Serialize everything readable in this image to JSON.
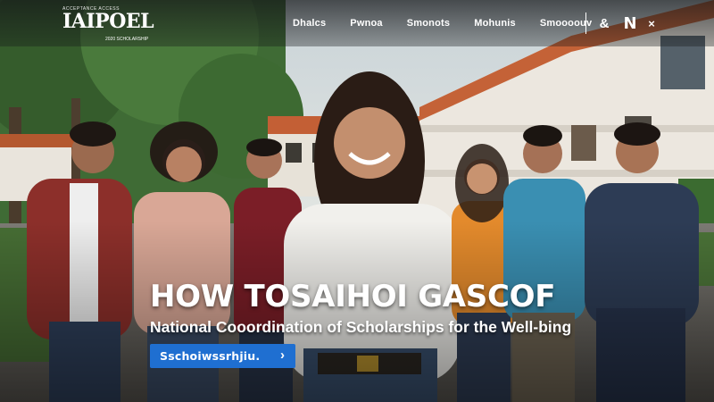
{
  "logo": {
    "small_top": "ACCEPTANCE ACCESS",
    "wordmark": "IAIPOEL",
    "tagline": "2020 SCHOLARSHIP"
  },
  "nav": {
    "items": [
      {
        "label": "Dhalcs"
      },
      {
        "label": "Pwnoa"
      },
      {
        "label": "Smonots"
      },
      {
        "label": "Mohunis"
      },
      {
        "label": "Smoooouv"
      }
    ],
    "icons": [
      "accessibility-icon",
      "n-icon",
      "close-icon"
    ],
    "icon_glyphs": {
      "accessibility": "&",
      "n": "N",
      "close": "×"
    }
  },
  "hero": {
    "title": "HOW TOSAIHOI GASCOF",
    "subtitle": "National Cooordination of Scholarships for the Well-bing",
    "cta_label": "Sschoiwssrhjiu.",
    "cta_arrow": "›"
  },
  "colors": {
    "cta": "#1f6fd1",
    "text": "#ffffff"
  }
}
